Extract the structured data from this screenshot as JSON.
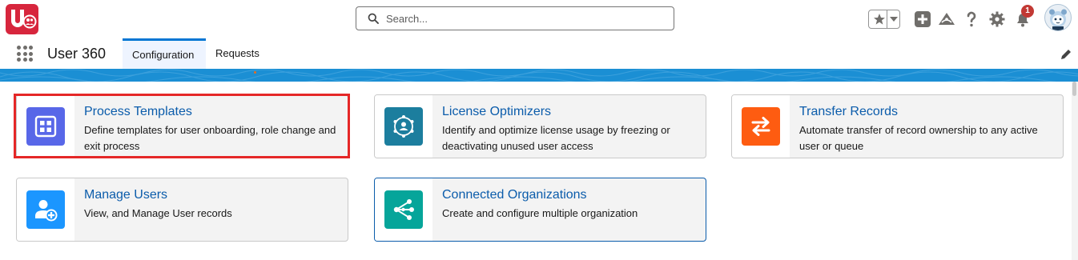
{
  "header": {
    "logo_icon": "u360-logo",
    "search": {
      "placeholder": "Search..."
    },
    "notifications_count": "1",
    "icons": [
      "star-favorites-icon",
      "add-icon",
      "trailhead-icon",
      "help-icon",
      "gear-icon",
      "bell-icon",
      "avatar"
    ]
  },
  "nav": {
    "app_name": "User 360",
    "tabs": [
      {
        "label": "Configuration",
        "active": true
      },
      {
        "label": "Requests",
        "active": false
      }
    ]
  },
  "cards": [
    {
      "title": "Process Templates",
      "description": "Define templates for user onboarding, role change and exit process",
      "icon": "grid-icon",
      "icon_color": "#5867e8",
      "highlighted": true
    },
    {
      "title": "License Optimizers",
      "description": "Identify and optimize license usage by freezing or deactivating unused user access",
      "icon": "license-optimizer-icon",
      "icon_color": "#1c7e9e"
    },
    {
      "title": "Transfer Records",
      "description": "Automate transfer of record ownership to any active user or queue",
      "icon": "transfer-arrows-icon",
      "icon_color": "#fe5c11"
    },
    {
      "title": "Manage Users",
      "description": "View, and Manage User records",
      "icon": "manage-users-icon",
      "icon_color": "#1b96ff"
    },
    {
      "title": "Connected Organizations",
      "description": "Create and configure multiple organization",
      "icon": "connected-orgs-icon",
      "icon_color": "#06a59a"
    }
  ],
  "colors": {
    "brand_red": "#d7263d",
    "link_blue": "#0b5cab",
    "tab_accent": "#0176d3",
    "highlight_red": "#e52727"
  }
}
